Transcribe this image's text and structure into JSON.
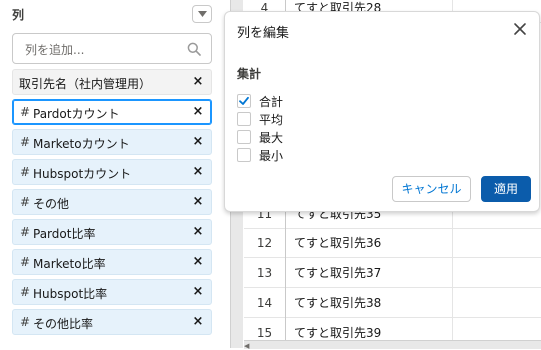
{
  "left_panel": {
    "title": "列",
    "search_placeholder": "列を追加...",
    "columns": [
      {
        "label": "取引先名（社内管理用）",
        "type": "grouping",
        "hash": ""
      },
      {
        "label": "Pardotカウント",
        "type": "selected",
        "hash": "#"
      },
      {
        "label": "Marketoカウント",
        "type": "measure",
        "hash": "#"
      },
      {
        "label": "Hubspotカウント",
        "type": "measure",
        "hash": "#"
      },
      {
        "label": "その他",
        "type": "measure",
        "hash": "#"
      },
      {
        "label": "Pardot比率",
        "type": "measure",
        "hash": "#"
      },
      {
        "label": "Marketo比率",
        "type": "measure",
        "hash": "#"
      },
      {
        "label": "Hubspot比率",
        "type": "measure",
        "hash": "#"
      },
      {
        "label": "その他比率",
        "type": "measure",
        "hash": "#"
      }
    ],
    "remove_glyph": "×"
  },
  "table": {
    "rows": [
      {
        "num": "4",
        "name": "てすと取引先28"
      },
      {
        "num": "11",
        "name": "てすと取引先35"
      },
      {
        "num": "12",
        "name": "てすと取引先36"
      },
      {
        "num": "13",
        "name": "てすと取引先37"
      },
      {
        "num": "14",
        "name": "てすと取引先38"
      },
      {
        "num": "15",
        "name": "てすと取引先39"
      }
    ]
  },
  "popover": {
    "title": "列を編集",
    "section_label": "集計",
    "options": [
      {
        "label": "合計",
        "checked": true
      },
      {
        "label": "平均",
        "checked": false
      },
      {
        "label": "最大",
        "checked": false
      },
      {
        "label": "最小",
        "checked": false
      }
    ],
    "cancel_label": "キャンセル",
    "apply_label": "適用"
  },
  "colors": {
    "accent": "#0176d3",
    "apply_bg": "#0b5cab",
    "pill_bg": "#e6f2fb",
    "selected_border": "#1b96ff"
  }
}
